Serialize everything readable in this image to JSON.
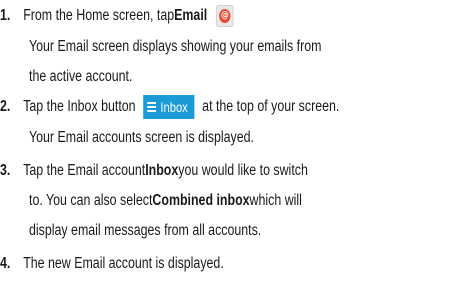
{
  "steps": [
    {
      "number": "1.",
      "line1": {
        "pre": "From the Home screen, tap ",
        "bold": "Email",
        "post": ""
      },
      "continuation": [
        "Your Email screen displays showing your emails from",
        "the active account."
      ]
    },
    {
      "number": "2.",
      "line1": {
        "pre": "Tap the Inbox button",
        "button": "Inbox",
        "post": "at the top of your screen."
      },
      "continuation": [
        "Your Email accounts screen is displayed."
      ]
    },
    {
      "number": "3.",
      "line1": {
        "pre": "Tap the Email account ",
        "bold": "Inbox",
        "post": " you would like to switch"
      },
      "line2": {
        "pre": "to. You can also select ",
        "bold": "Combined inbox",
        "post": " which will"
      },
      "continuation": [
        "display email messages from all accounts."
      ]
    },
    {
      "number": "4.",
      "line1": {
        "pre": "The new Email account is displayed."
      }
    }
  ],
  "icons": {
    "email_icon_glyph": "@",
    "email_icon_color": "#e8472f",
    "inbox_button_color": "#1a9ad6"
  }
}
